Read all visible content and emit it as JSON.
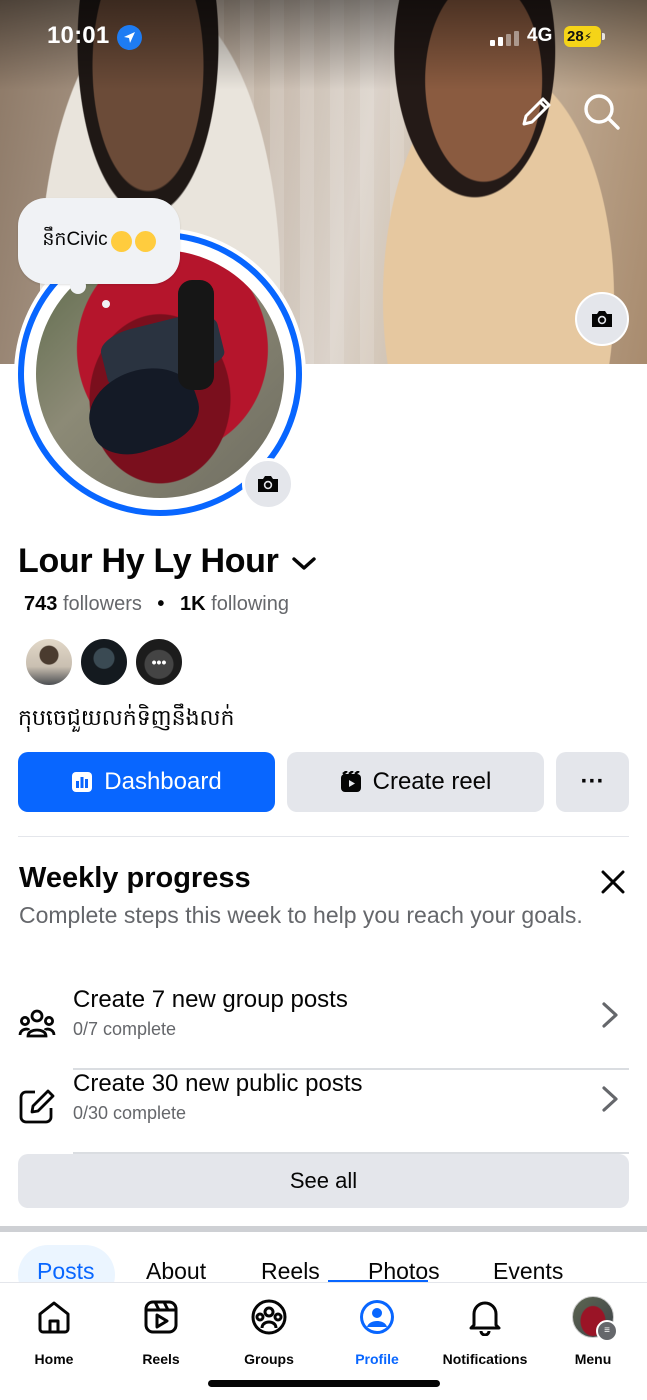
{
  "status_bar": {
    "time": "10:01",
    "network": "4G",
    "battery": "28"
  },
  "cover": {
    "top_icons": [
      "pencil-icon",
      "search-icon"
    ],
    "camera_icon": "camera-icon"
  },
  "profile": {
    "note": "នឹកCivic",
    "name": "Lour Hy Ly Hour",
    "followers_count": "743",
    "followers_label": "followers",
    "following_count": "1K",
    "following_label": "following",
    "more_friends_label": "•••",
    "bio": "កុបចេជួយលក់ទិញនឹងលក់"
  },
  "actions": {
    "dashboard_label": "Dashboard",
    "create_reel_label": "Create reel",
    "more_label": "···"
  },
  "weekly_progress": {
    "title": "Weekly progress",
    "subtitle": "Complete steps this week to help you reach your goals.",
    "tasks": [
      {
        "title": "Create 7 new group posts",
        "status": "0/7 complete",
        "icon": "group-icon"
      },
      {
        "title": "Create 30 new public posts",
        "status": "0/30 complete",
        "icon": "edit-icon"
      }
    ],
    "see_all_label": "See all"
  },
  "profile_tabs": [
    "Posts",
    "About",
    "Reels",
    "Photos",
    "Events"
  ],
  "profile_tabs_active": "Posts",
  "bottom_nav": [
    {
      "label": "Home",
      "icon": "home-icon"
    },
    {
      "label": "Reels",
      "icon": "reels-icon"
    },
    {
      "label": "Groups",
      "icon": "groups-icon"
    },
    {
      "label": "Profile",
      "icon": "profile-icon"
    },
    {
      "label": "Notifications",
      "icon": "bell-icon"
    },
    {
      "label": "Menu",
      "icon": "menu-avatar"
    }
  ],
  "bottom_nav_active": "Profile",
  "colors": {
    "accent": "#0866ff",
    "button_gray": "#e4e6eb",
    "secondary_text": "#65676b",
    "battery": "#f5d418"
  }
}
